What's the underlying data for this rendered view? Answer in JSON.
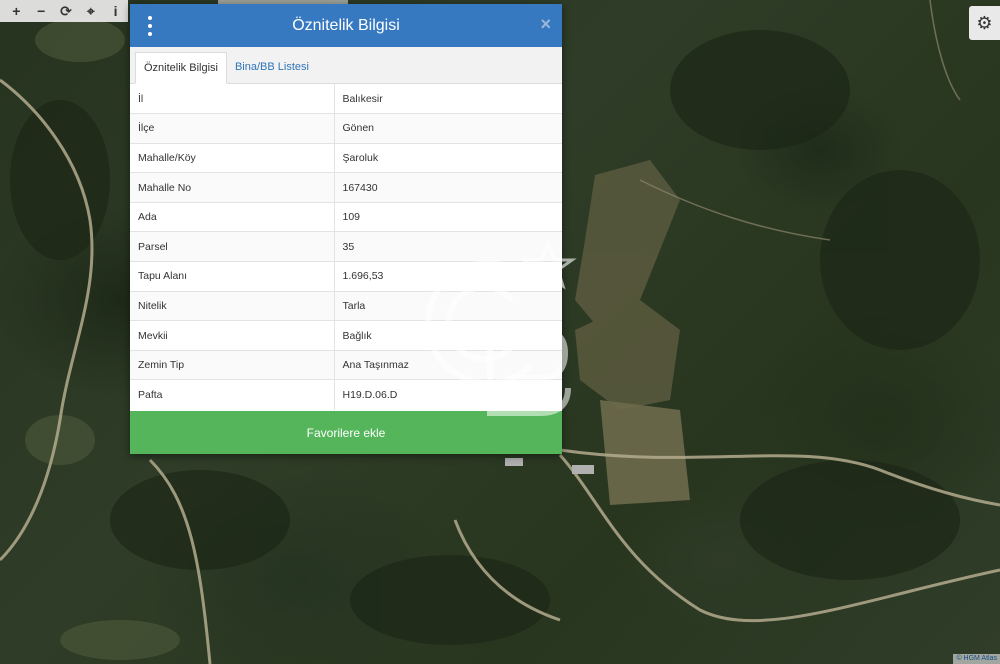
{
  "map_toolbar": {
    "zoom_in": "+",
    "zoom_out": "−",
    "refresh": "⟳",
    "locate": "⌖",
    "info": "i"
  },
  "settings_icon": "gear-icon",
  "attribution": "© HGM Atlas",
  "panel": {
    "title": "Öznitelik Bilgisi",
    "close_label": "×",
    "tabs": [
      {
        "label": "Öznitelik Bilgisi",
        "active": true
      },
      {
        "label": "Bina/BB Listesi",
        "active": false
      }
    ],
    "rows": [
      {
        "key": "İl",
        "value": "Balıkesir"
      },
      {
        "key": "İlçe",
        "value": "Gönen"
      },
      {
        "key": "Mahalle/Köy",
        "value": "Şaroluk"
      },
      {
        "key": "Mahalle No",
        "value": "167430"
      },
      {
        "key": "Ada",
        "value": "109"
      },
      {
        "key": "Parsel",
        "value": "35"
      },
      {
        "key": "Tapu Alanı",
        "value": "1.696,53"
      },
      {
        "key": "Nitelik",
        "value": "Tarla"
      },
      {
        "key": "Mevkii",
        "value": "Bağlık"
      },
      {
        "key": "Zemin Tip",
        "value": "Ana Taşınmaz"
      },
      {
        "key": "Pafta",
        "value": "H19.D.06.D"
      }
    ],
    "favorite_button": "Favorilere ekle"
  },
  "colors": {
    "header": "#3779c1",
    "favorite": "#54b55a",
    "tab_link": "#2f75b9"
  }
}
